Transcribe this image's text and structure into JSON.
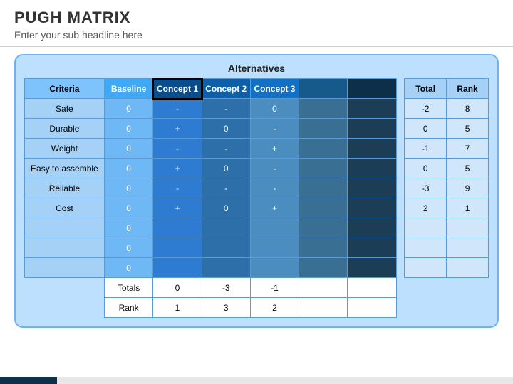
{
  "header": {
    "title": "PUGH MATRIX",
    "subtitle": "Enter your sub headline here"
  },
  "alt_title": "Alternatives",
  "cols": {
    "criteria": "Criteria",
    "baseline": "Baseline",
    "c1": "Concept 1",
    "c2": "Concept 2",
    "c3": "Concept 3",
    "total": "Total",
    "rank": "Rank"
  },
  "rows": [
    {
      "crit": "Safe",
      "base": "0",
      "c1": "-",
      "c2": "-",
      "c3": "0",
      "tot": "-2",
      "rank": "8"
    },
    {
      "crit": "Durable",
      "base": "0",
      "c1": "+",
      "c2": "0",
      "c3": "-",
      "tot": "0",
      "rank": "5"
    },
    {
      "crit": "Weight",
      "base": "0",
      "c1": "-",
      "c2": "-",
      "c3": "+",
      "tot": "-1",
      "rank": "7"
    },
    {
      "crit": "Easy to assemble",
      "base": "0",
      "c1": "+",
      "c2": "0",
      "c3": "-",
      "tot": "0",
      "rank": "5"
    },
    {
      "crit": "Reliable",
      "base": "0",
      "c1": "-",
      "c2": "-",
      "c3": "-",
      "tot": "-3",
      "rank": "9"
    },
    {
      "crit": "Cost",
      "base": "0",
      "c1": "+",
      "c2": "0",
      "c3": "+",
      "tot": "2",
      "rank": "1"
    },
    {
      "crit": "",
      "base": "0",
      "c1": "",
      "c2": "",
      "c3": "",
      "tot": "",
      "rank": ""
    },
    {
      "crit": "",
      "base": "0",
      "c1": "",
      "c2": "",
      "c3": "",
      "tot": "",
      "rank": ""
    },
    {
      "crit": "",
      "base": "0",
      "c1": "",
      "c2": "",
      "c3": "",
      "tot": "",
      "rank": ""
    }
  ],
  "footer": {
    "totals_label": "Totals",
    "t1": "0",
    "t2": "-3",
    "t3": "-1",
    "rank_label": "Rank",
    "r1": "1",
    "r2": "3",
    "r3": "2"
  }
}
